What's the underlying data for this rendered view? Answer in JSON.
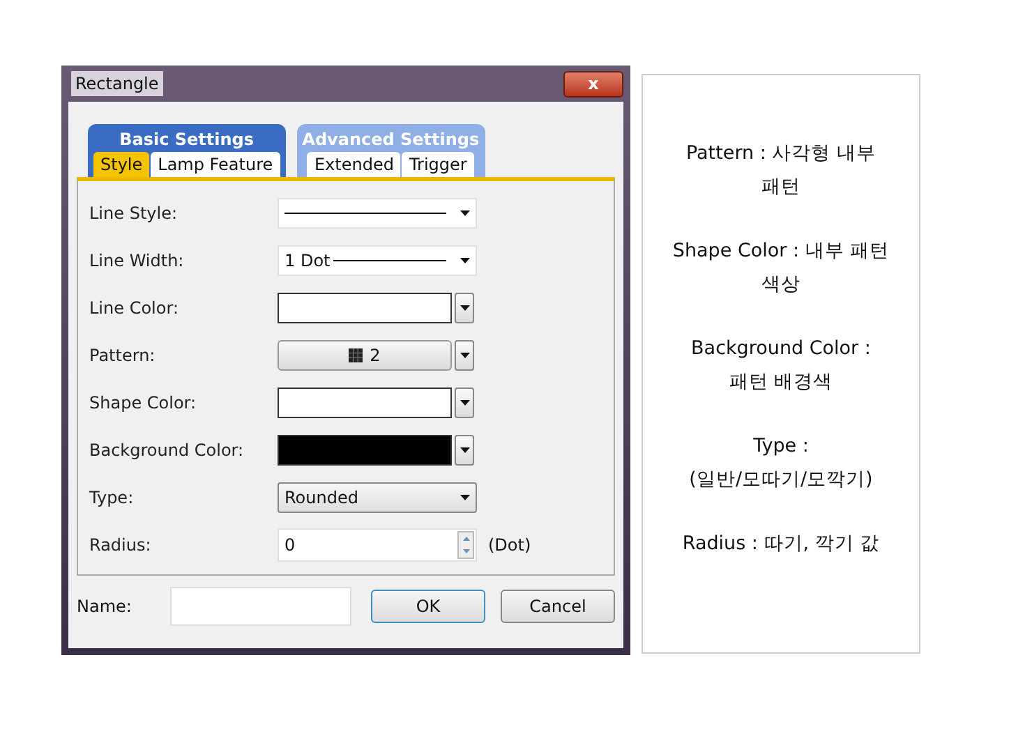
{
  "window": {
    "title": "Rectangle",
    "close": "x"
  },
  "tab_groups": [
    {
      "label": "Basic Settings",
      "selected": true,
      "tabs": [
        {
          "label": "Style",
          "selected": true
        },
        {
          "label": "Lamp Feature",
          "selected": false
        }
      ]
    },
    {
      "label": "Advanced Settings",
      "selected": false,
      "tabs": [
        {
          "label": "Extended",
          "selected": false
        },
        {
          "label": "Trigger",
          "selected": false
        }
      ]
    }
  ],
  "fields": [
    {
      "kind": "line",
      "label": "Line Style:"
    },
    {
      "kind": "line",
      "label": "Line Width:",
      "value": "1 Dot"
    },
    {
      "kind": "color",
      "label": "Line Color:",
      "color": "#ffffff"
    },
    {
      "kind": "pattern",
      "label": "Pattern:",
      "value": "2"
    },
    {
      "kind": "color",
      "label": "Shape Color:",
      "color": "#ffffff"
    },
    {
      "kind": "color",
      "label": "Background Color:",
      "color": "#000000"
    },
    {
      "kind": "select",
      "label": "Type:",
      "value": "Rounded"
    },
    {
      "kind": "spin",
      "label": "Radius:",
      "value": "0",
      "unit": "(Dot)"
    }
  ],
  "footer": {
    "name_label": "Name:",
    "buttons": [
      {
        "label": "OK",
        "kind": "default"
      },
      {
        "label": "Cancel",
        "kind": "normal"
      }
    ]
  },
  "notes": [
    {
      "lines": [
        "Pattern : 사각형 내부",
        "패턴"
      ]
    },
    {
      "lines": [
        "Shape Color : 내부 패턴",
        "색상"
      ]
    },
    {
      "lines": [
        "Background Color :",
        "패턴 배경색"
      ]
    },
    {
      "lines": [
        "Type :",
        "(일반/모따기/모깍기)"
      ]
    },
    {
      "lines": [
        "Radius : 따기, 깍기 값"
      ]
    }
  ]
}
